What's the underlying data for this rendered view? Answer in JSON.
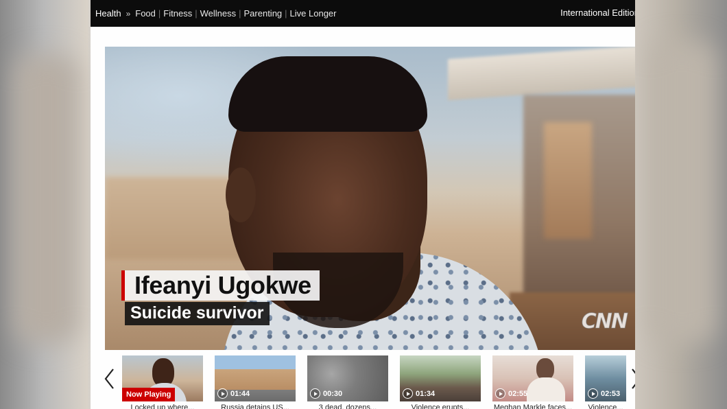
{
  "nav": {
    "section": "Health",
    "separator": "»",
    "items": [
      "Food",
      "Fitness",
      "Wellness",
      "Parenting",
      "Live Longer"
    ],
    "edition": "International Edition"
  },
  "video": {
    "lower_third": {
      "name": "Ifeanyi Ugokwe",
      "title": "Suicide survivor"
    },
    "watermark": "CNN"
  },
  "carousel": {
    "items": [
      {
        "label": "Now Playing",
        "duration": "",
        "caption": "Locked up where..."
      },
      {
        "label": "",
        "duration": "01:44",
        "caption": "Russia detains US..."
      },
      {
        "label": "",
        "duration": "00:30",
        "caption": "3 dead, dozens..."
      },
      {
        "label": "",
        "duration": "01:34",
        "caption": "Violence erupts..."
      },
      {
        "label": "",
        "duration": "02:55",
        "caption": "Meghan Markle faces..."
      },
      {
        "label": "",
        "duration": "02:53",
        "caption": "Violence..."
      }
    ]
  },
  "colors": {
    "nav_bg": "#0c0c0c",
    "accent_red": "#cc0000"
  },
  "icons": {
    "carousel_prev": "chevron-left-icon",
    "carousel_next": "chevron-right-icon",
    "play": "play-circle-icon"
  }
}
